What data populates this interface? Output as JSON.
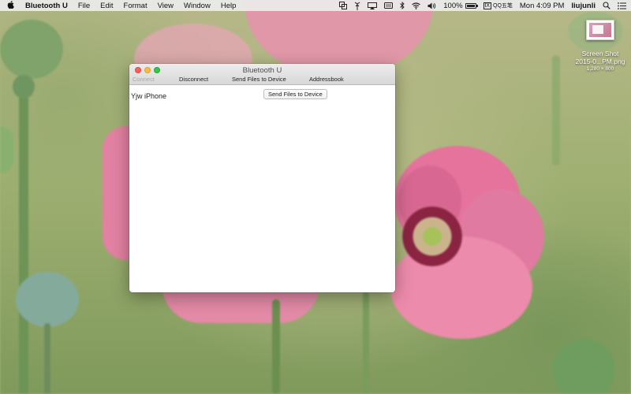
{
  "menubar": {
    "app_name": "Bluetooth U",
    "menus": [
      "File",
      "Edit",
      "Format",
      "View",
      "Window",
      "Help"
    ],
    "status": {
      "battery_percent": "100%",
      "battery_level": 1.0,
      "input_method": "QQ五笔",
      "input_method_box": "Ⅸ",
      "clock": "Mon 4:09 PM",
      "user": "liujunli"
    }
  },
  "desktop_file": {
    "name_line1": "Screen Shot",
    "name_line2": "2015-0...PM.png",
    "size": "1,280 × 800"
  },
  "window": {
    "title": "Bluetooth U",
    "toolbar": {
      "connect": "Connect",
      "disconnect": "Disconnect",
      "send_files": "Send Files to Device",
      "addressbook": "Addressbook"
    },
    "device_name": "Yjw iPhone",
    "send_button": "Send Files to Device"
  },
  "colors": {
    "close": "#fc605b",
    "minimize": "#fdbc40",
    "maximize": "#34c84a"
  }
}
